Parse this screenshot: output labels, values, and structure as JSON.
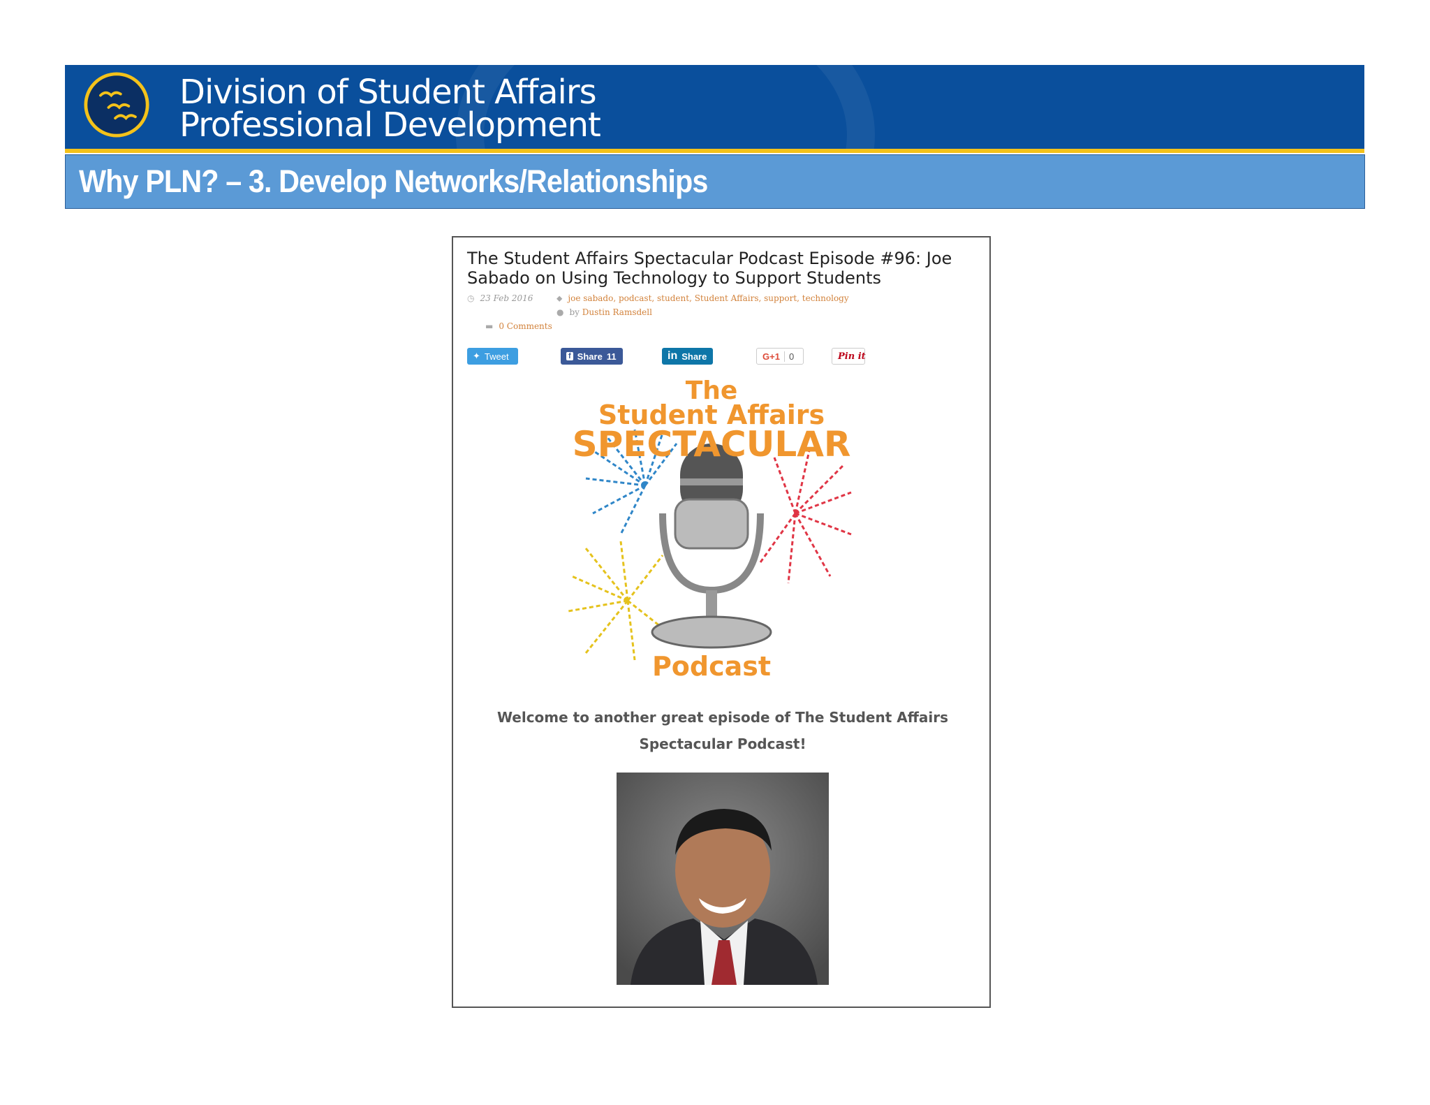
{
  "banner": {
    "line1": "Division of Student Affairs",
    "line2": "Professional Development",
    "brand_color": "#0a4f9c",
    "stripe_color": "#f4c21a"
  },
  "slide": {
    "title": "Why PLN? – 3. Develop Networks/Relationships",
    "title_bar_color": "#5b9ad6"
  },
  "article": {
    "title": "The Student Affairs Spectacular Podcast Episode #96: Joe Sabado on Using Technology to Support Students",
    "date": "23 Feb 2016",
    "tags": "joe sabado, podcast, student, Student Affairs, support, technology",
    "author_prefix": "by",
    "author": "Dustin Ramsdell",
    "comments": "0 Comments",
    "share": {
      "tweet": "Tweet",
      "facebook": "Share",
      "facebook_count": "11",
      "linkedin": "Share",
      "gplus": "G+1",
      "gplus_count": "0",
      "pinterest": "Pin it"
    },
    "podcast_logo": {
      "line1": "The",
      "line2": "Student Affairs",
      "line3": "SPECTACULAR",
      "line4": "Podcast",
      "accent_color": "#f0962e"
    },
    "welcome_line1": "Welcome to another great episode of The Student Affairs",
    "welcome_line2": "Spectacular Podcast!"
  }
}
